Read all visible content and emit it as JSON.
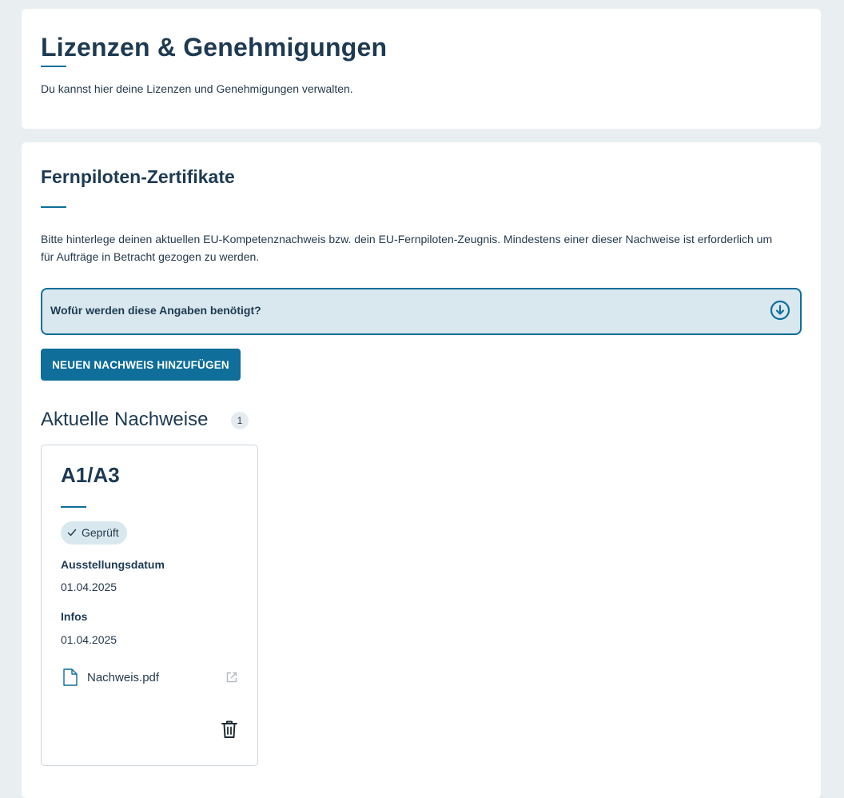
{
  "header": {
    "title": "Lizenzen & Genehmigungen",
    "subtitle": "Du kannst hier deine Lizenzen und Genehmigungen verwalten."
  },
  "section": {
    "title": "Fernpiloten-Zertifikate",
    "description": "Bitte hinterlege deinen aktuellen EU-Kompetenznachweis bzw. dein EU-Fernpiloten-Zeugnis. Mindestens einer dieser Nachweise ist erforderlich um für Aufträge in Betracht gezogen zu werden.",
    "accordion_label": "Wofür werden diese Angaben benötigt?",
    "add_button": "NEUEN NACHWEIS HINZUFÜGEN"
  },
  "list": {
    "title": "Aktuelle Nachweise",
    "count": "1"
  },
  "certificate": {
    "title": "A1/A3",
    "status": "Geprüft",
    "issue_date_label": "Ausstellungsdatum",
    "issue_date": "01.04.2025",
    "info_label": "Infos",
    "info_value": "01.04.2025",
    "file_name": "Nachweis.pdf"
  },
  "colors": {
    "accent": "#0f6e9a",
    "heading": "#1e3a52",
    "accordion_bg": "#d9e8ee",
    "page_bg": "#e9eef1"
  },
  "icons": [
    "arrow-down-circle-icon",
    "check-icon",
    "file-icon",
    "external-link-icon",
    "trash-icon"
  ]
}
